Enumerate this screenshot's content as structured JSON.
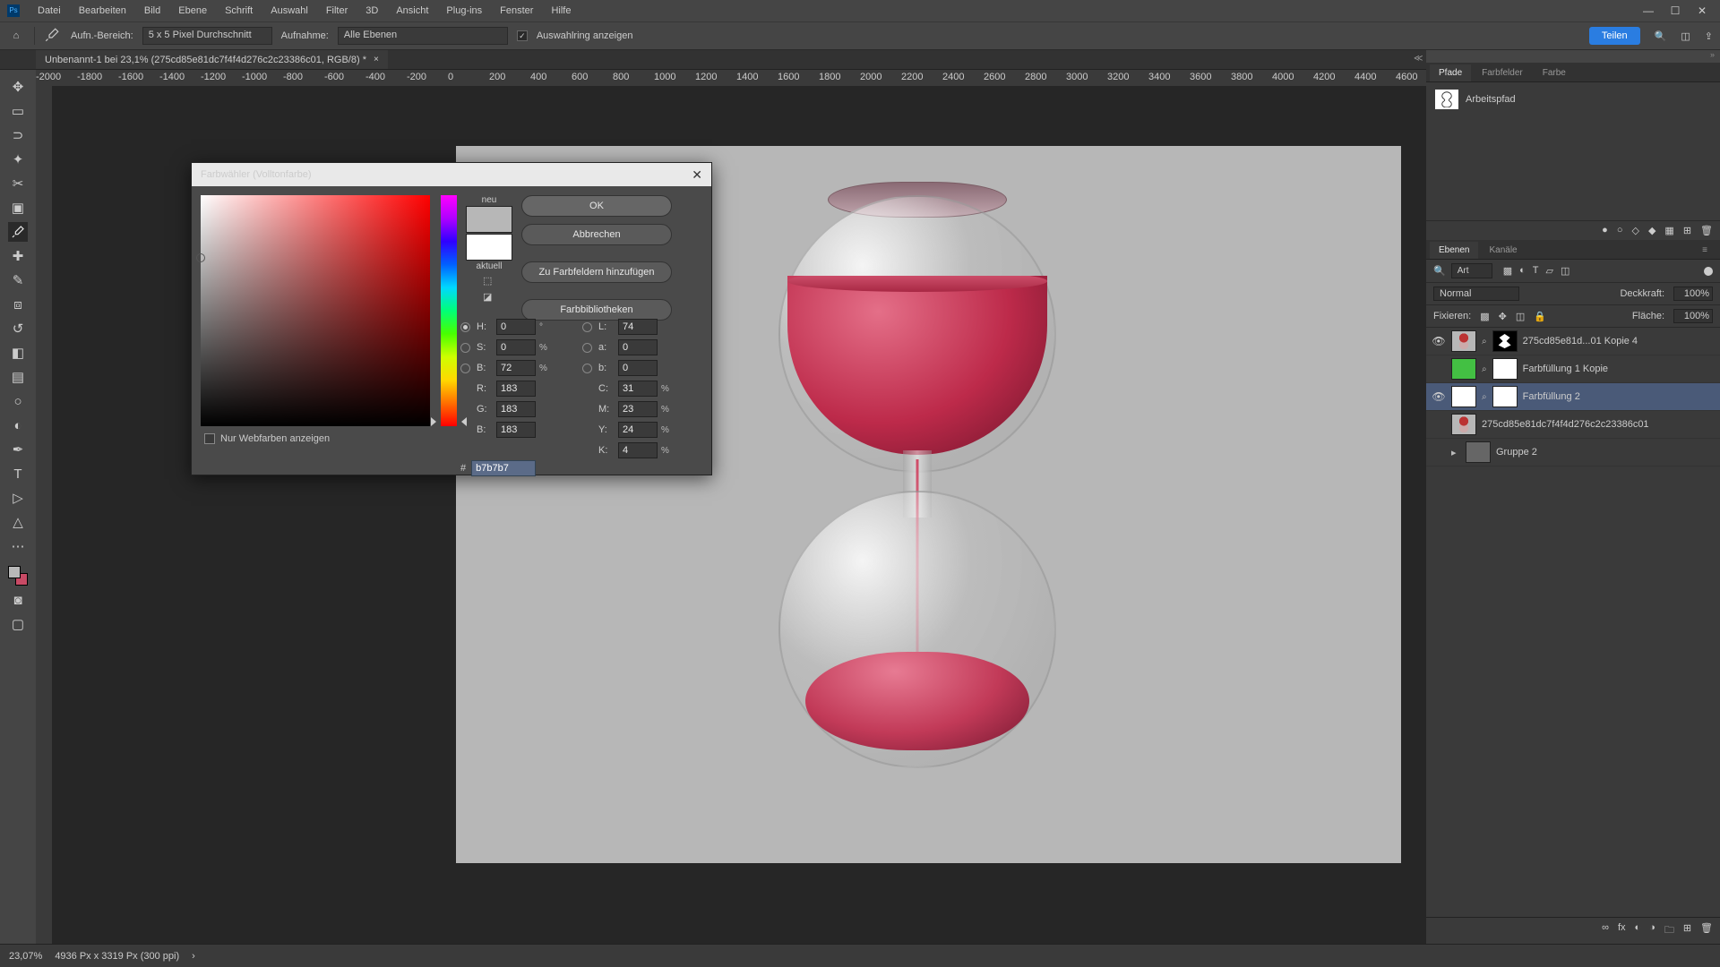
{
  "menu": {
    "items": [
      "Datei",
      "Bearbeiten",
      "Bild",
      "Ebene",
      "Schrift",
      "Auswahl",
      "Filter",
      "3D",
      "Ansicht",
      "Plug-ins",
      "Fenster",
      "Hilfe"
    ]
  },
  "optbar": {
    "sample_label": "Aufn.-Bereich:",
    "sample_value": "5 x 5 Pixel Durchschnitt",
    "sample_layers_label": "Aufnahme:",
    "sample_layers_value": "Alle Ebenen",
    "show_ring_label": "Auswahlring anzeigen",
    "show_ring_checked": true,
    "share": "Teilen"
  },
  "doc": {
    "tab": "Unbenannt-1 bei 23,1% (275cd85e81dc7f4f4d276c2c23386c01, RGB/8) *"
  },
  "ruler": [
    "-2000",
    "-1800",
    "-1600",
    "-1400",
    "-1200",
    "-1000",
    "-800",
    "-600",
    "-400",
    "-200",
    "0",
    "200",
    "400",
    "600",
    "800",
    "1000",
    "1200",
    "1400",
    "1600",
    "1800",
    "2000",
    "2200",
    "2400",
    "2600",
    "2800",
    "3000",
    "3200",
    "3400",
    "3600",
    "3800",
    "4000",
    "4200",
    "4400",
    "4600"
  ],
  "status": {
    "zoom": "23,07%",
    "info": "4936 Px x 3319 Px (300 ppi)"
  },
  "rightpanels": {
    "paths": {
      "tabs": [
        "Pfade",
        "Farbfelder",
        "Farbe"
      ],
      "active": 0,
      "item": "Arbeitspfad"
    },
    "layers": {
      "tabs": [
        "Ebenen",
        "Kanäle"
      ],
      "active": 0,
      "search_kind": "Art",
      "blend_mode": "Normal",
      "opacity_label": "Deckkraft:",
      "opacity": "100%",
      "lock_label": "Fixieren:",
      "fill_label": "Fläche:",
      "fill": "100%",
      "items": [
        {
          "visible": true,
          "thumbs": [
            "img",
            "maskshape"
          ],
          "name": "275cd85e81d...01 Kopie 4",
          "link": true
        },
        {
          "visible": false,
          "thumbs": [
            "green",
            "mask"
          ],
          "name": "Farbfüllung 1 Kopie",
          "link": true
        },
        {
          "visible": true,
          "thumbs": [
            "white",
            "mask"
          ],
          "name": "Farbfüllung 2",
          "link": true,
          "selected": true
        },
        {
          "visible": false,
          "thumbs": [
            "img"
          ],
          "name": "275cd85e81dc7f4f4d276c2c23386c01"
        },
        {
          "visible": false,
          "group": true,
          "name": "Gruppe 2"
        }
      ]
    }
  },
  "dialog": {
    "title": "Farbwähler (Volltonfarbe)",
    "new_label": "neu",
    "current_label": "aktuell",
    "buttons": {
      "ok": "OK",
      "cancel": "Abbrechen",
      "add": "Zu Farbfeldern hinzufügen",
      "libs": "Farbbibliotheken"
    },
    "fields": {
      "H": {
        "label": "H:",
        "value": "0",
        "unit": "°"
      },
      "S": {
        "label": "S:",
        "value": "0",
        "unit": "%"
      },
      "Bv": {
        "label": "B:",
        "value": "72",
        "unit": "%"
      },
      "R": {
        "label": "R:",
        "value": "183"
      },
      "G": {
        "label": "G:",
        "value": "183"
      },
      "Bc": {
        "label": "B:",
        "value": "183"
      },
      "L": {
        "label": "L:",
        "value": "74"
      },
      "a": {
        "label": "a:",
        "value": "0"
      },
      "b": {
        "label": "b:",
        "value": "0"
      },
      "C": {
        "label": "C:",
        "value": "31",
        "unit": "%"
      },
      "M": {
        "label": "M:",
        "value": "23",
        "unit": "%"
      },
      "Y": {
        "label": "Y:",
        "value": "24",
        "unit": "%"
      },
      "K": {
        "label": "K:",
        "value": "4",
        "unit": "%"
      },
      "hex": {
        "label": "#",
        "value": "b7b7b7"
      }
    },
    "webonly": "Nur Webfarben anzeigen"
  }
}
